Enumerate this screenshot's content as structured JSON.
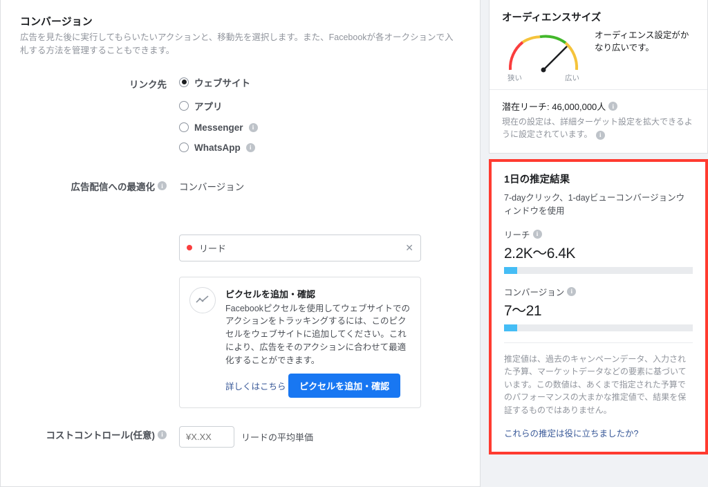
{
  "main": {
    "title": "コンバージョン",
    "description": "広告を見た後に実行してもらいたいアクションと、移動先を選択します。また、Facebookが各オークションで入札する方法を管理することもできます。",
    "destination": {
      "label": "リンク先",
      "options": [
        "ウェブサイト",
        "アプリ",
        "Messenger",
        "WhatsApp"
      ],
      "selected": "ウェブサイト"
    },
    "optimization": {
      "label": "広告配信への最適化",
      "value": "コンバージョン"
    },
    "event_pill": {
      "value": "リード"
    },
    "pixel_callout": {
      "title": "ピクセルを追加・確認",
      "body": "Facebookピクセルを使用してウェブサイトでのアクションをトラッキングするには、このピクセルをウェブサイトに追加してください。これにより、広告をそのアクションに合わせて最適化することができます。",
      "link": "詳しくはこちら",
      "button": "ピクセルを追加・確認"
    },
    "cost_control": {
      "label": "コストコントロール(任意)",
      "placeholder": "¥X.XX",
      "suffix": "リードの平均単価"
    }
  },
  "side": {
    "audience": {
      "title": "オーディエンスサイズ",
      "gauge_min": "狭い",
      "gauge_max": "広い",
      "summary": "オーディエンス設定がかなり広いです。",
      "reach_label": "潜在リーチ: 46,000,000人",
      "reach_desc": "現在の設定は、詳細ターゲット設定を拡大できるように設定されています。"
    },
    "daily": {
      "title": "1日の推定結果",
      "window": "7-dayクリック、1-dayビューコンバージョンウィンドウを使用",
      "reach_label": "リーチ",
      "reach_value": "2.2K～6.4K",
      "conv_label": "コンバージョン",
      "conv_value": "7～21",
      "disclaimer": "推定値は、過去のキャンペーンデータ、入力された予算、マーケットデータなどの要素に基づいています。この数値は、あくまで指定された予算でのパフォーマンスの大まかな推定値で、結果を保証するものではありません。",
      "feedback_link": "これらの推定は役に立ちましたか?"
    }
  }
}
